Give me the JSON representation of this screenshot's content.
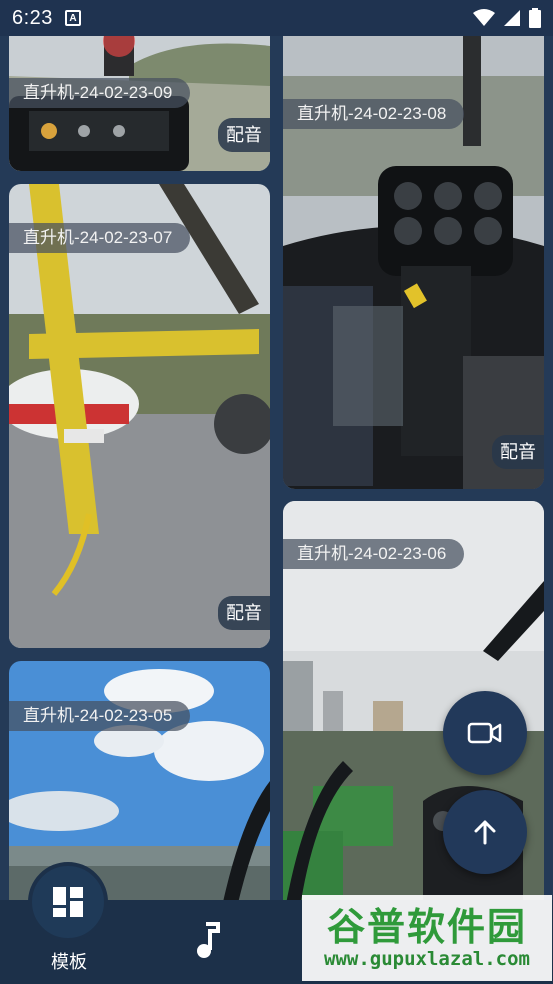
{
  "status_bar": {
    "time": "6:23",
    "notif_icon_letter": "A"
  },
  "cards": [
    {
      "title": "直升机-24-02-23-09",
      "dub": "配音"
    },
    {
      "title": "直升机-24-02-23-08",
      "dub": "配音"
    },
    {
      "title": "直升机-24-02-23-07",
      "dub": "配音"
    },
    {
      "title": "直升机-24-02-23-06",
      "dub": ""
    },
    {
      "title": "直升机-24-02-23-05",
      "dub": ""
    }
  ],
  "nav": {
    "template_label": "模板"
  },
  "watermark": {
    "main": "谷普软件园",
    "url": "www.gupuxlazal.com"
  },
  "colors": {
    "background": "#243a57",
    "nav_bg": "#1c3049",
    "fab_bg": "#22395a"
  }
}
